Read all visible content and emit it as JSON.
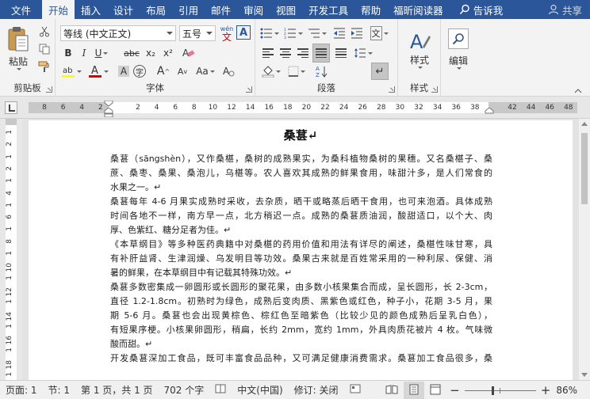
{
  "menubar": {
    "tabs": [
      "文件",
      "开始",
      "插入",
      "设计",
      "布局",
      "引用",
      "邮件",
      "审阅",
      "视图",
      "开发工具",
      "帮助",
      "福昕阅读器"
    ],
    "active_tab": "开始",
    "tell_me": "告诉我",
    "share": "共享"
  },
  "ribbon": {
    "clipboard": {
      "label": "剪贴板",
      "paste": "粘贴"
    },
    "font": {
      "label": "字体",
      "font_name": "等线 (中文正文)",
      "font_size": "五号",
      "wen": "wén",
      "wen_char": "文",
      "bold": "B",
      "italic": "I",
      "underline": "U",
      "strike": "abc",
      "subscript": "x₂",
      "superscript": "x²",
      "grow": "A",
      "shrink": "A",
      "case": "Aa",
      "highlight_color": "#ffff00",
      "font_color": "#e00000"
    },
    "paragraph": {
      "label": "段落"
    },
    "styles": {
      "label": "样式",
      "button": "样式"
    },
    "editing": {
      "button": "编辑"
    }
  },
  "ruler": {
    "h_ticks": [
      "8",
      "6",
      "4",
      "2",
      "",
      "2",
      "4",
      "6",
      "8",
      "10",
      "12",
      "14",
      "16",
      "18",
      "20",
      "22",
      "24",
      "26",
      "28",
      "30",
      "32",
      "34",
      "36",
      "38",
      "",
      "42",
      "44",
      "46",
      "48"
    ],
    "v_ticks": [
      "1",
      "2",
      "1",
      "2",
      "1",
      "4",
      "1",
      "6",
      "1",
      "8",
      "1",
      "10",
      "1",
      "12",
      "1",
      "14",
      "1",
      "16",
      "1",
      "18",
      "1",
      "20"
    ]
  },
  "document": {
    "title": "桑葚↵",
    "paragraphs": [
      {
        "lines": [
          "桑葚（sāngshèn），又作桑椹，桑树的成熟果实，为桑科植物桑树的果穗。又名桑椹子、桑",
          "蔗、桑枣、桑果、桑泡儿，乌椹等。农人喜欢其成熟的鲜果食用，味甜汁多，是人们常食的",
          "水果之一。↵"
        ]
      },
      {
        "lines": [
          "桑葚每年 4-6 月果实成熟时采收，去杂质，晒干或略蒸后晒干食用，也可来泡酒。具体成熟",
          "时间各地不一样，南方早一点，北方稍迟一点。成熟的桑葚质油润，酸甜适口，以个大、肉",
          "厚、色紫红、糖分足者为佳。↵"
        ]
      },
      {
        "lines": [
          "《本草纲目》等多种医药典籍中对桑椹的药用价值和用法有详尽的阐述，桑椹性味甘寒，具",
          "有补肝益肾、生津润燥、乌发明目等功效。桑果古来就是百姓常采用的一种利尿、保健、消",
          "暑的鲜果，在本草纲目中有记载其特殊功效。↵"
        ]
      },
      {
        "lines": [
          "桑葚多数密集成一卵圆形或长圆形的聚花果，由多数小核果集合而成，呈长圆形，长 2-3cm，",
          "直径 1.2-1.8cm。初熟时为绿色，成熟后变肉质、黑紫色或红色，种子小，花期 3-5 月，果",
          "期 5-6 月。桑葚也会出现黄棕色、棕红色至暗紫色（比较少见的颜色成熟后呈乳白色），",
          "有短果序梗。小核果卵圆形，稍扁，长约 2mm，宽约 1mm，外具肉质花被片 4 枚。气味微",
          "酸而甜。↵"
        ]
      },
      {
        "lines": [
          "开发桑葚深加工食品，既可丰富食品品种，又可满足健康消费需求。桑葚加工食品很多，桑"
        ]
      }
    ]
  },
  "status": {
    "page": "页面: 1",
    "section": "节: 1",
    "page_of": "第 1 页，共 1 页",
    "words": "702 个字",
    "language": "中文(中国)",
    "track": "修订: 关闭",
    "zoom": "86%"
  }
}
